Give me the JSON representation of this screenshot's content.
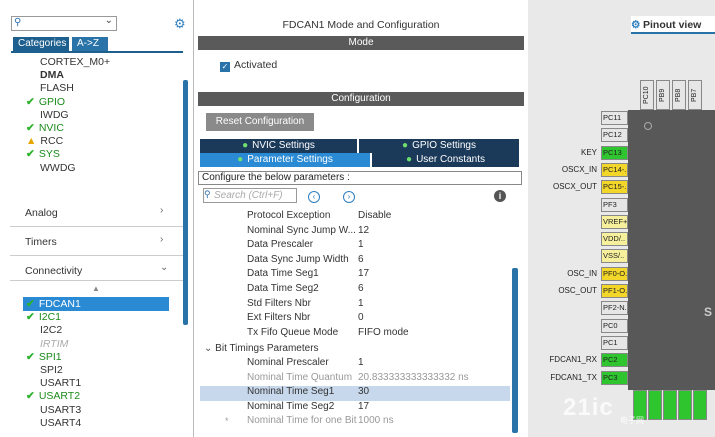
{
  "left": {
    "search": {
      "placeholder": ""
    },
    "tabs": [
      "Categories",
      "A->Z"
    ],
    "system_items": [
      {
        "label": "CORTEX_M0+",
        "status": "none"
      },
      {
        "label": "DMA",
        "status": "bold"
      },
      {
        "label": "FLASH",
        "status": "none"
      },
      {
        "label": "GPIO",
        "status": "ok"
      },
      {
        "label": "IWDG",
        "status": "none"
      },
      {
        "label": "NVIC",
        "status": "ok"
      },
      {
        "label": "RCC",
        "status": "warn"
      },
      {
        "label": "SYS",
        "status": "ok"
      },
      {
        "label": "WWDG",
        "status": "none"
      }
    ],
    "sections": [
      "Analog",
      "Timers",
      "Connectivity"
    ],
    "connectivity_items": [
      {
        "label": "FDCAN1",
        "status": "ok",
        "selected": true
      },
      {
        "label": "I2C1",
        "status": "ok"
      },
      {
        "label": "I2C2",
        "status": "none"
      },
      {
        "label": "IRTIM",
        "status": "disabled"
      },
      {
        "label": "SPI1",
        "status": "ok"
      },
      {
        "label": "SPI2",
        "status": "none"
      },
      {
        "label": "USART1",
        "status": "none"
      },
      {
        "label": "USART2",
        "status": "ok"
      },
      {
        "label": "USART3",
        "status": "none"
      },
      {
        "label": "USART4",
        "status": "none"
      }
    ]
  },
  "middle": {
    "title": "FDCAN1 Mode and Configuration",
    "mode_bar": "Mode",
    "activated_label": "Activated",
    "config_bar": "Configuration",
    "reset_button": "Reset Configuration",
    "settings_tabs": [
      "NVIC Settings",
      "GPIO Settings",
      "Parameter Settings",
      "User Constants"
    ],
    "params_label": "Configure the below parameters :",
    "param_search_placeholder": "Search (Ctrl+F)",
    "info_glyph": "i",
    "params": [
      {
        "name": "Protocol Exception",
        "value": "Disable"
      },
      {
        "name": "Nominal Sync Jump W...",
        "value": "12"
      },
      {
        "name": "Data Prescaler",
        "value": "1"
      },
      {
        "name": "Data Sync Jump Width",
        "value": "6"
      },
      {
        "name": "Data Time Seg1",
        "value": "17"
      },
      {
        "name": "Data Time Seg2",
        "value": "6"
      },
      {
        "name": "Std Filters Nbr",
        "value": "1"
      },
      {
        "name": "Ext Filters Nbr",
        "value": "0"
      },
      {
        "name": "Tx Fifo Queue Mode",
        "value": "FIFO mode"
      }
    ],
    "bit_timings_header": "Bit Timings Parameters",
    "bit_timings": [
      {
        "name": "Nominal Prescaler",
        "value": "1",
        "grey": false
      },
      {
        "name": "Nominal Time Quantum",
        "value": "20.833333333333332 ns",
        "grey": true
      },
      {
        "name": "Nominal Time Seg1",
        "value": "30",
        "grey": false,
        "selected": true
      },
      {
        "name": "Nominal Time Seg2",
        "value": "17",
        "grey": false
      },
      {
        "name": "Nominal Time for one Bit",
        "value": "1000 ns",
        "grey": true
      }
    ]
  },
  "right": {
    "tab_label": "Pinout view",
    "top_pins": [
      "PC10",
      "PB9",
      "PB8",
      "PB7"
    ],
    "left_pins": [
      {
        "pin": "PC11",
        "label": "",
        "color": "gray"
      },
      {
        "pin": "PC12",
        "label": "",
        "color": "gray"
      },
      {
        "pin": "PC13",
        "label": "KEY",
        "color": "green"
      },
      {
        "pin": "PC14-..",
        "label": "OSCX_IN",
        "color": "yellow"
      },
      {
        "pin": "PC15-..",
        "label": "OSCX_OUT",
        "color": "yellow"
      },
      {
        "pin": "PF3",
        "label": "",
        "color": "gray"
      },
      {
        "pin": "VREF+",
        "label": "",
        "color": "lightyellow"
      },
      {
        "pin": "VDD/..",
        "label": "",
        "color": "lightyellow"
      },
      {
        "pin": "VSS/..",
        "label": "",
        "color": "lightyellow"
      },
      {
        "pin": "PF0-O..",
        "label": "OSC_IN",
        "color": "yellow"
      },
      {
        "pin": "PF1-O..",
        "label": "OSC_OUT",
        "color": "yellow"
      },
      {
        "pin": "PF2-N..",
        "label": "",
        "color": "gray"
      },
      {
        "pin": "PC0",
        "label": "",
        "color": "gray"
      },
      {
        "pin": "PC1",
        "label": "",
        "color": "gray"
      },
      {
        "pin": "PC2",
        "label": "FDCAN1_RX",
        "color": "green"
      },
      {
        "pin": "PC3",
        "label": "FDCAN1_TX",
        "color": "green"
      }
    ],
    "chip_letter": "S",
    "watermark": "21ic",
    "watermark_sub": "电子网"
  },
  "colors": {
    "accent": "#2a73a8",
    "ok": "#2db32d",
    "warn": "#e6a800",
    "pin_green": "#2fc52f",
    "pin_yellow": "#f2d62a"
  }
}
